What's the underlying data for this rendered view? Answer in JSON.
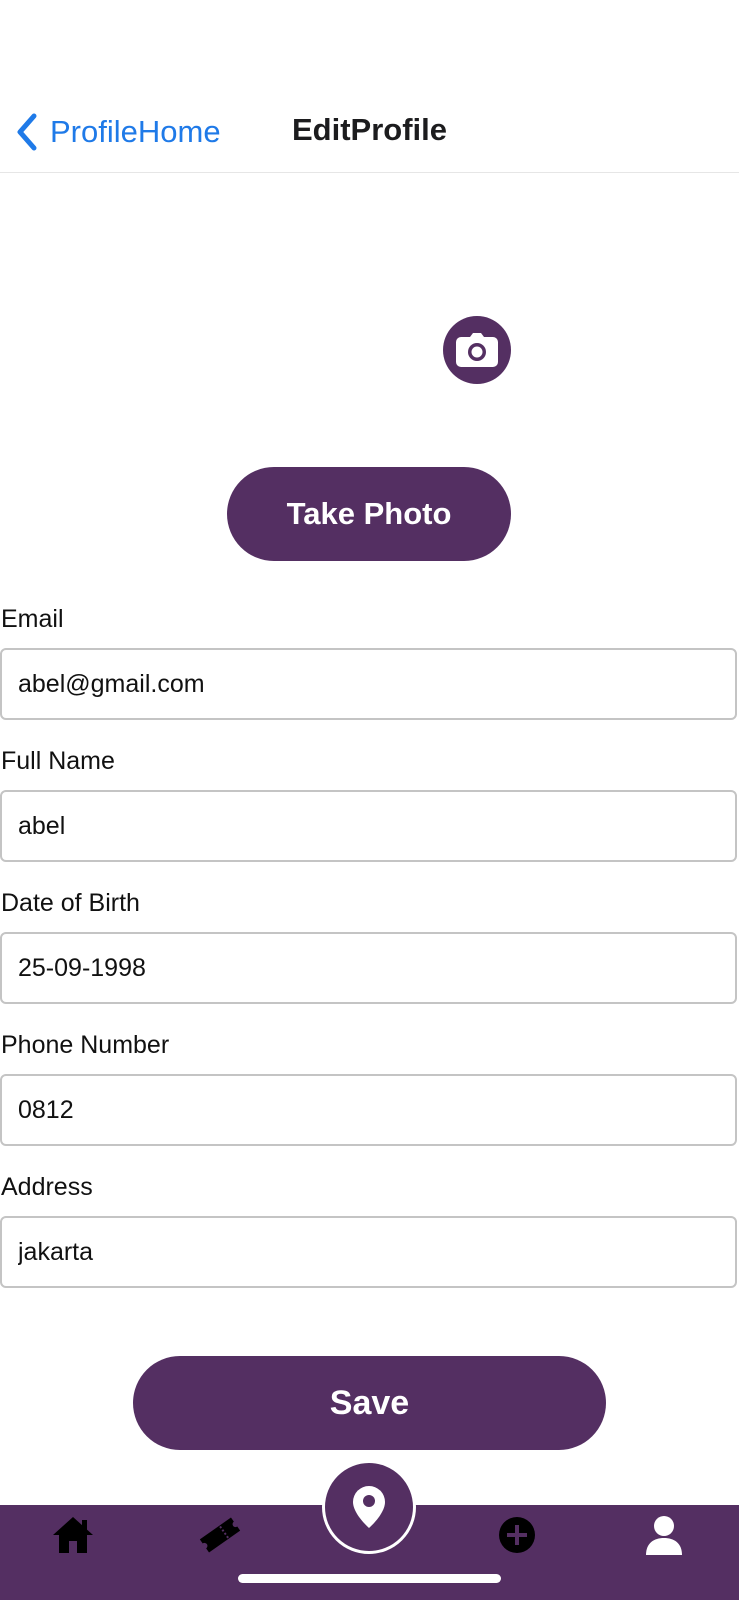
{
  "header": {
    "back_label": "ProfileHome",
    "title": "EditProfile"
  },
  "photo": {
    "camera_icon": "camera-icon",
    "take_photo_label": "Take Photo"
  },
  "form": {
    "email": {
      "label": "Email",
      "value": "abel@gmail.com"
    },
    "full_name": {
      "label": "Full Name",
      "value": "abel"
    },
    "dob": {
      "label": "Date of Birth",
      "value": "25-09-1998"
    },
    "phone": {
      "label": "Phone Number",
      "value": "0812"
    },
    "address": {
      "label": "Address",
      "value": "jakarta"
    }
  },
  "save_label": "Save",
  "tabs": [
    {
      "icon": "home-icon"
    },
    {
      "icon": "ticket-icon"
    },
    {
      "icon": "location-pin-icon"
    },
    {
      "icon": "add-circle-icon"
    },
    {
      "icon": "user-icon"
    }
  ],
  "colors": {
    "accent": "#542f62",
    "link": "#1f7ae8"
  }
}
